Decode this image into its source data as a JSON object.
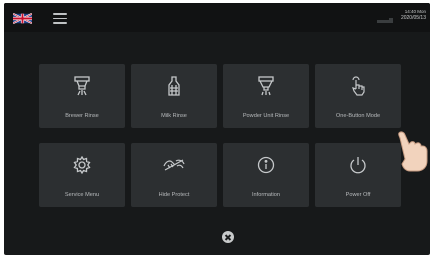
{
  "header": {
    "flag_icon": "uk-flag-icon",
    "menu_icon": "hamburger-menu-icon",
    "clock_time": "14:40 Mon",
    "clock_date": "2020/05/13"
  },
  "tiles": [
    {
      "label": "Brewer Rinse",
      "icon": "brewer-icon"
    },
    {
      "label": "Milk Rinse",
      "icon": "milk-jug-icon"
    },
    {
      "label": "Powder Unit Rinse",
      "icon": "powder-unit-icon"
    },
    {
      "label": "One-Button Mode",
      "icon": "touch-hand-icon"
    },
    {
      "label": "Service Menu",
      "icon": "gear-icon"
    },
    {
      "label": "Hide Protect",
      "icon": "hide-protect-icon"
    },
    {
      "label": "Information",
      "icon": "info-icon"
    },
    {
      "label": "Power Off",
      "icon": "power-icon"
    }
  ],
  "close_icon": "close-icon",
  "colors": {
    "background": "#17191a",
    "tile": "#2c2f31",
    "text": "#b7babc"
  }
}
